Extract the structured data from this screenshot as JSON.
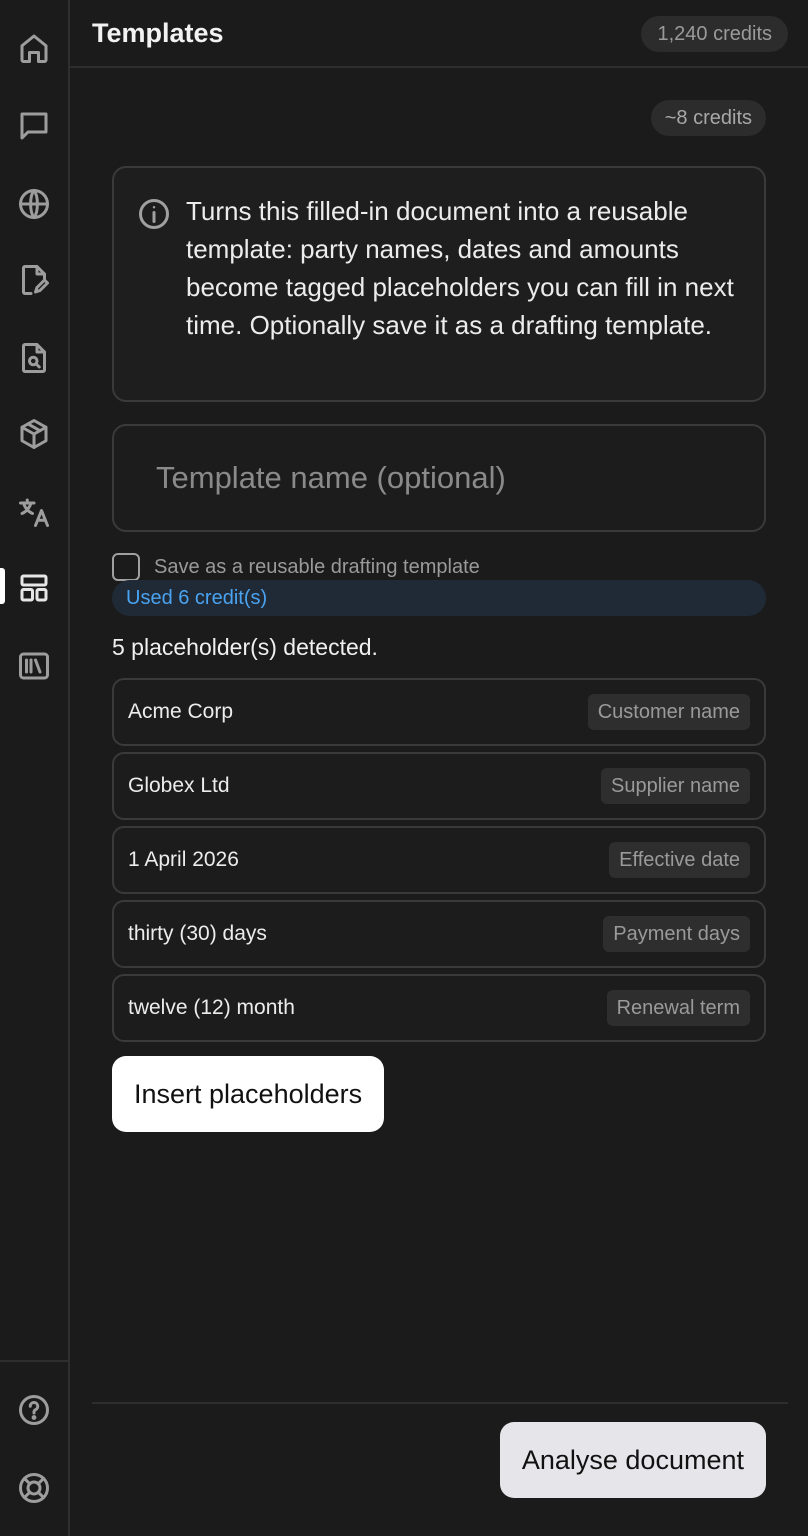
{
  "sidebar": {
    "items": [
      {
        "name": "home-icon",
        "active": false
      },
      {
        "name": "chat-icon",
        "active": false
      },
      {
        "name": "globe-icon",
        "active": false
      },
      {
        "name": "document-edit-icon",
        "active": false
      },
      {
        "name": "document-search-icon",
        "active": false
      },
      {
        "name": "cube-icon",
        "active": false
      },
      {
        "name": "translate-icon",
        "active": false
      },
      {
        "name": "templates-layout-icon",
        "active": true
      },
      {
        "name": "library-icon",
        "active": false
      }
    ],
    "bottom_items": [
      {
        "name": "help-icon"
      },
      {
        "name": "support-lifebuoy-icon"
      }
    ]
  },
  "header": {
    "title": "Templates",
    "credits": "1,240 credits"
  },
  "main": {
    "cost_badge": "~8 credits",
    "info_text": "Turns this filled-in document into a reusable template: party names, dates and amounts become tagged placeholders you can fill in next time. Optionally save it as a drafting template.",
    "template_name": {
      "value": "",
      "placeholder": "Template name (optional)"
    },
    "save_checkbox_label": "Save as a reusable drafting template",
    "used_credits": "Used 6 credit(s)",
    "detected": "5 placeholder(s) detected.",
    "placeholders": [
      {
        "value": "Acme Corp",
        "tag": "Customer name"
      },
      {
        "value": "Globex Ltd",
        "tag": "Supplier name"
      },
      {
        "value": "1 April 2026",
        "tag": "Effective date"
      },
      {
        "value": "thirty (30) days",
        "tag": "Payment days"
      },
      {
        "value": "twelve (12) month",
        "tag": "Renewal term"
      }
    ],
    "insert_button": "Insert placeholders"
  },
  "footer": {
    "analyse_button": "Analyse document"
  },
  "colors": {
    "background": "#1b1b1b",
    "accent_link": "#4aa3f0",
    "banner_bg": "#1f2a36"
  }
}
